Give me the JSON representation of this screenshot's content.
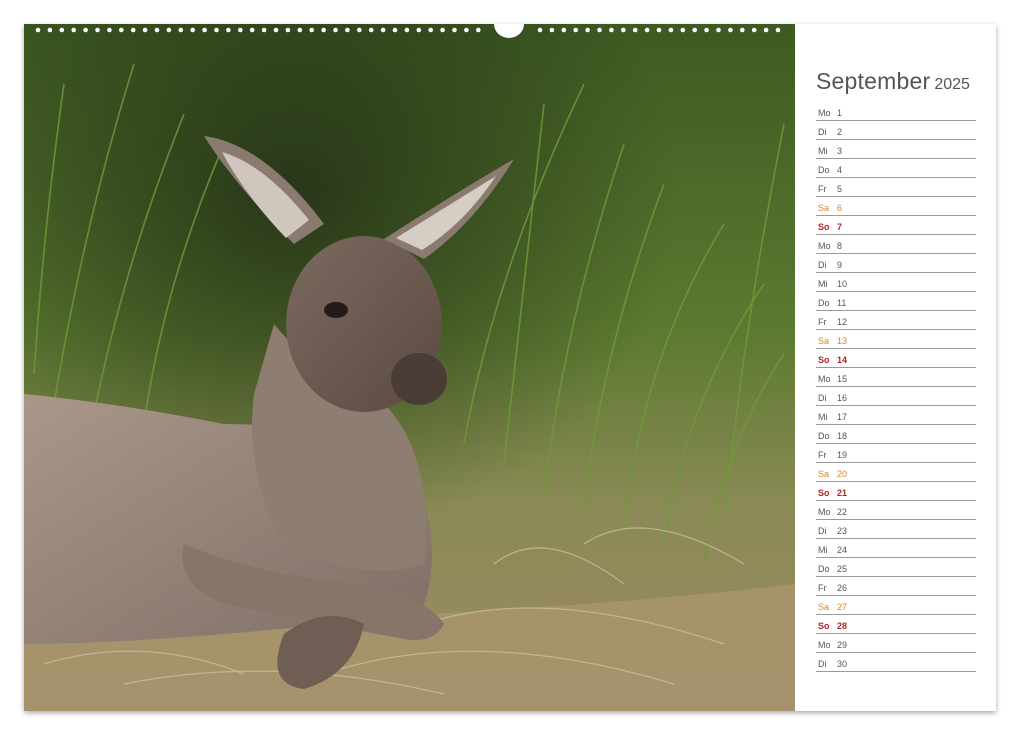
{
  "calendar": {
    "month": "September",
    "year": "2025",
    "days": [
      {
        "wd": "Mo",
        "n": "1",
        "type": "weekday"
      },
      {
        "wd": "Di",
        "n": "2",
        "type": "weekday"
      },
      {
        "wd": "Mi",
        "n": "3",
        "type": "weekday"
      },
      {
        "wd": "Do",
        "n": "4",
        "type": "weekday"
      },
      {
        "wd": "Fr",
        "n": "5",
        "type": "weekday"
      },
      {
        "wd": "Sa",
        "n": "6",
        "type": "saturday"
      },
      {
        "wd": "So",
        "n": "7",
        "type": "sunday"
      },
      {
        "wd": "Mo",
        "n": "8",
        "type": "weekday"
      },
      {
        "wd": "Di",
        "n": "9",
        "type": "weekday"
      },
      {
        "wd": "Mi",
        "n": "10",
        "type": "weekday"
      },
      {
        "wd": "Do",
        "n": "11",
        "type": "weekday"
      },
      {
        "wd": "Fr",
        "n": "12",
        "type": "weekday"
      },
      {
        "wd": "Sa",
        "n": "13",
        "type": "saturday"
      },
      {
        "wd": "So",
        "n": "14",
        "type": "sunday"
      },
      {
        "wd": "Mo",
        "n": "15",
        "type": "weekday"
      },
      {
        "wd": "Di",
        "n": "16",
        "type": "weekday"
      },
      {
        "wd": "Mi",
        "n": "17",
        "type": "weekday"
      },
      {
        "wd": "Do",
        "n": "18",
        "type": "weekday"
      },
      {
        "wd": "Fr",
        "n": "19",
        "type": "weekday"
      },
      {
        "wd": "Sa",
        "n": "20",
        "type": "saturday"
      },
      {
        "wd": "So",
        "n": "21",
        "type": "sunday"
      },
      {
        "wd": "Mo",
        "n": "22",
        "type": "weekday"
      },
      {
        "wd": "Di",
        "n": "23",
        "type": "weekday"
      },
      {
        "wd": "Mi",
        "n": "24",
        "type": "weekday"
      },
      {
        "wd": "Do",
        "n": "25",
        "type": "weekday"
      },
      {
        "wd": "Fr",
        "n": "26",
        "type": "weekday"
      },
      {
        "wd": "Sa",
        "n": "27",
        "type": "saturday"
      },
      {
        "wd": "So",
        "n": "28",
        "type": "sunday"
      },
      {
        "wd": "Mo",
        "n": "29",
        "type": "weekday"
      },
      {
        "wd": "Di",
        "n": "30",
        "type": "weekday"
      }
    ]
  },
  "colors": {
    "saturday": "#d9852a",
    "sunday": "#b0251f",
    "weekday": "#555555"
  },
  "photo": {
    "subject": "kangaroo-lying-in-grass"
  }
}
